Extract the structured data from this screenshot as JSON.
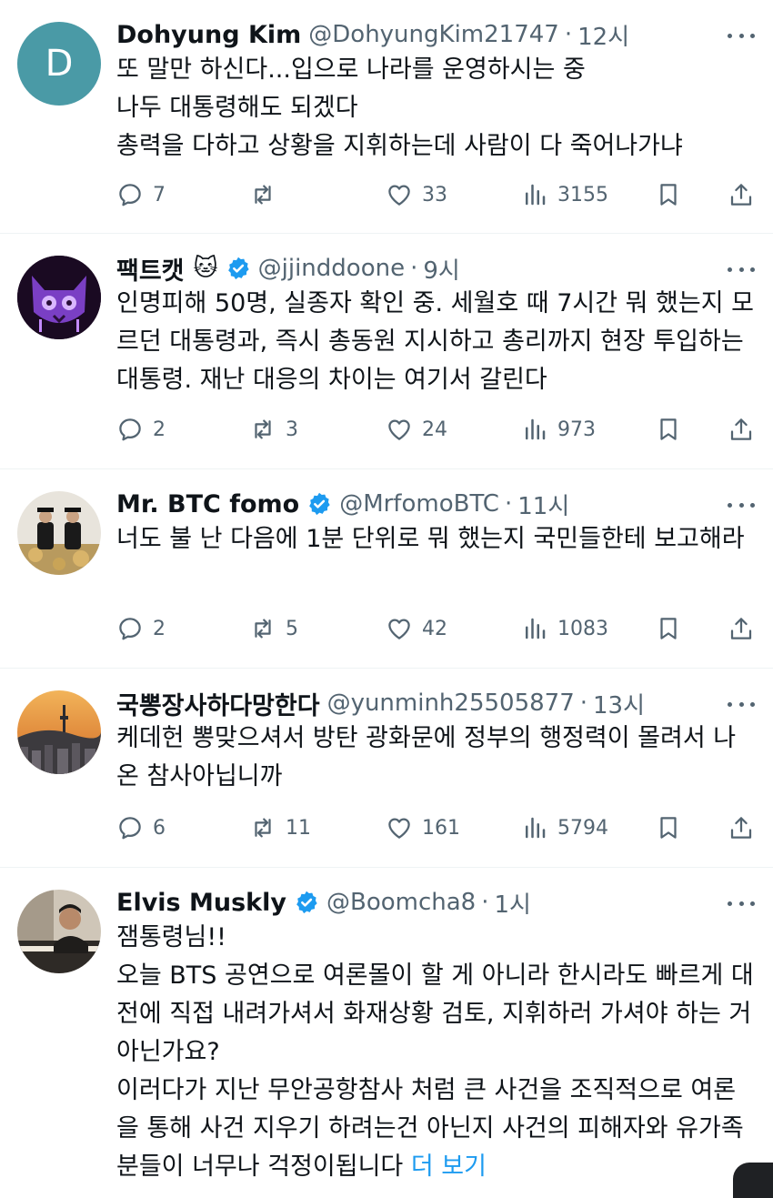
{
  "tweets": [
    {
      "name": "Dohyung Kim",
      "emoji": "",
      "verified": false,
      "handle": "@DohyungKim21747",
      "time": "12시",
      "avatar_letter": "D",
      "text": "또 말만 하신다...입으로 나라를 운영하시는 중\n나두 대통령해도 되겠다\n총력을 다하고 상황을 지휘하는데 사람이 다 죽어나가냐",
      "replies": "7",
      "reposts": "",
      "likes": "33",
      "views": "3155"
    },
    {
      "name": "팩트캣",
      "emoji": "🐱",
      "verified": true,
      "handle": "@jjinddoone",
      "time": "9시",
      "text": "인명피해 50명, 실종자 확인 중. 세월호 때 7시간 뭐 했는지 모르던 대통령과, 즉시 총동원 지시하고 총리까지 현장 투입하는 대통령. 재난 대응의 차이는 여기서 갈린다",
      "replies": "2",
      "reposts": "3",
      "likes": "24",
      "views": "973"
    },
    {
      "name": "Mr. BTC fomo",
      "emoji": "",
      "verified": true,
      "handle": "@MrfomoBTC",
      "time": "11시",
      "text": "너도 불 난 다음에 1분 단위로 뭐 했는지 국민들한테 보고해라",
      "replies": "2",
      "reposts": "5",
      "likes": "42",
      "views": "1083"
    },
    {
      "name": "국뽕장사하다망한다",
      "emoji": "",
      "verified": false,
      "handle": "@yunminh25505877",
      "time": "13시",
      "text": "케데헌 뽕맞으셔서 방탄 광화문에 정부의 행정력이 몰려서 나온 참사아닙니까",
      "replies": "6",
      "reposts": "11",
      "likes": "161",
      "views": "5794"
    },
    {
      "name": "Elvis Muskly",
      "emoji": "",
      "verified": true,
      "handle": "@Boomcha8",
      "time": "1시",
      "text": "잼통령님!!\n오늘 BTS 공연으로 여론몰이 할 게 아니라 한시라도 빠르게 대전에 직접 내려가셔서 화재상황 검토, 지휘하러 가셔야 하는 거 아닌가요?\n이러다가 지난 무안공항참사 처럼 큰 사건을 조직적으로 여론을 통해 사건 지우기 하려는건 아닌지 사건의 피해자와 유가족분들이 너무나 걱정이됩니다",
      "show_more": "더 보기"
    }
  ],
  "colors": {
    "accent": "#1d9bf0",
    "muted": "#536471",
    "text": "#0f1419",
    "separator": "#eff3f4"
  },
  "icons": {
    "reply": "reply-icon",
    "repost": "repost-icon",
    "like": "like-icon",
    "views": "views-icon",
    "bookmark": "bookmark-icon",
    "share": "share-icon",
    "verified": "verified-badge-icon",
    "more": "more-icon"
  }
}
